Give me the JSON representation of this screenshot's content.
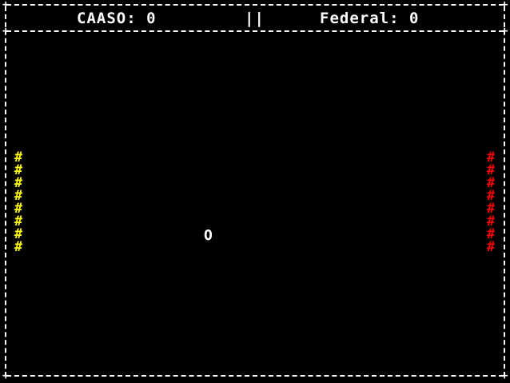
{
  "hud": {
    "left_team": "CAASO",
    "left_score": "0",
    "pause_symbol": "||",
    "right_team": "Federal",
    "right_score": "0"
  },
  "board": {
    "border_char": "+",
    "ball_char": "O"
  },
  "left_paddle": {
    "color": "#ffff00",
    "segments": [
      "#",
      "#",
      "#",
      "#",
      "#",
      "#",
      "#",
      "#"
    ]
  },
  "right_paddle": {
    "color": "#ff0000",
    "segments": [
      "#",
      "#",
      "#",
      "#",
      "#",
      "#",
      "#",
      "#"
    ]
  }
}
